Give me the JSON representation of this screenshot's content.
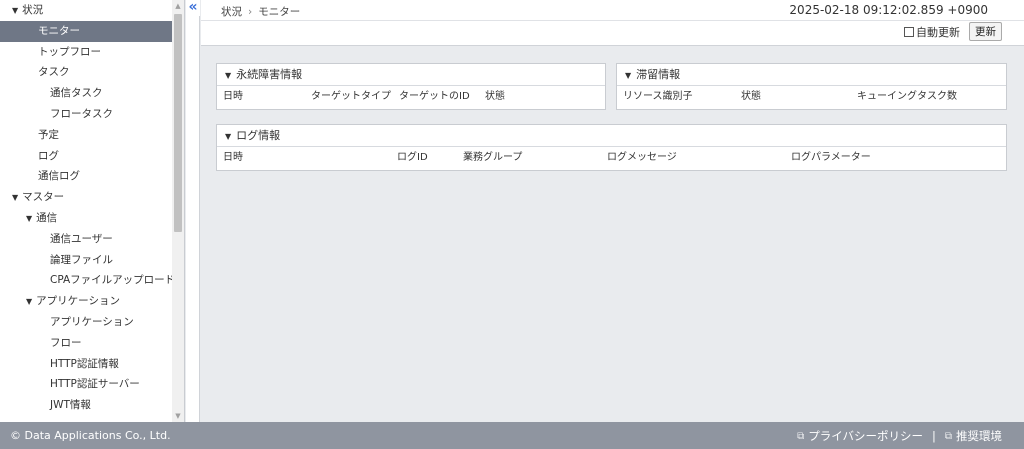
{
  "sidebar": {
    "items": [
      {
        "label": "状況",
        "toggle": "▼",
        "level": 0,
        "active": false
      },
      {
        "label": "モニター",
        "level": 1,
        "active": true
      },
      {
        "label": "トップフロー",
        "level": 1,
        "active": false
      },
      {
        "label": "タスク",
        "level": 1,
        "active": false
      },
      {
        "label": "通信タスク",
        "level": 2,
        "active": false
      },
      {
        "label": "フロータスク",
        "level": 2,
        "active": false
      },
      {
        "label": "予定",
        "level": 1,
        "active": false
      },
      {
        "label": "ログ",
        "level": 1,
        "active": false
      },
      {
        "label": "通信ログ",
        "level": 1,
        "active": false
      },
      {
        "label": "マスター",
        "toggle": "▼",
        "level": 0,
        "active": false
      },
      {
        "label": "通信",
        "toggle": "▼",
        "level": 1,
        "active": false
      },
      {
        "label": "通信ユーザー",
        "level": 2,
        "active": false
      },
      {
        "label": "論理ファイル",
        "level": 2,
        "active": false
      },
      {
        "label": "CPAファイルアップロード",
        "level": 2,
        "active": false
      },
      {
        "label": "アプリケーション",
        "toggle": "▼",
        "level": 1,
        "active": false
      },
      {
        "label": "アプリケーション",
        "level": 2,
        "active": false
      },
      {
        "label": "フロー",
        "level": 2,
        "active": false
      },
      {
        "label": "HTTP認証情報",
        "level": 2,
        "active": false
      },
      {
        "label": "HTTP認証サーバー",
        "level": 2,
        "active": false
      },
      {
        "label": "JWT情報",
        "level": 2,
        "active": false
      }
    ]
  },
  "header": {
    "breadcrumb": [
      "状況",
      "モニター"
    ],
    "breadcrumb_sep": "›",
    "timestamp": "2025-02-18 09:12:02.859 +0900",
    "auto_refresh_label": "自動更新",
    "refresh_label": "更新"
  },
  "panels": {
    "failure": {
      "title": "永続障害情報",
      "columns": [
        "日時",
        "ターゲットタイプ",
        "ターゲットのID",
        "状態"
      ]
    },
    "stagnation": {
      "title": "滞留情報",
      "columns": [
        "リソース識別子",
        "状態",
        "キューイングタスク数"
      ]
    },
    "log": {
      "title": "ログ情報",
      "columns": [
        "日時",
        "ログID",
        "業務グループ",
        "ログメッセージ",
        "ログパラメーター"
      ]
    }
  },
  "footer": {
    "copyright": "© Data Applications Co., Ltd.",
    "privacy": "プライバシーポリシー",
    "separator": "|",
    "env": "推奨環境"
  },
  "colors": {
    "active_nav_bg": "#6f7786",
    "footer_bg": "#8f95a0",
    "page_bg": "#e9ebee",
    "collapse_icon": "#3a6fd8"
  }
}
